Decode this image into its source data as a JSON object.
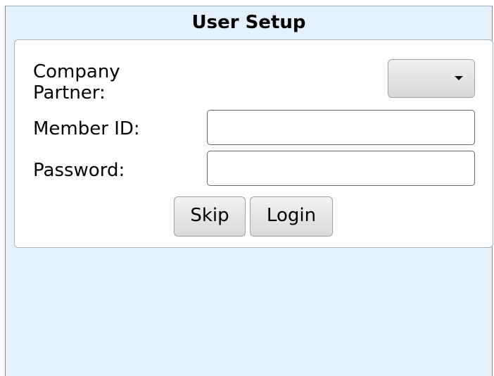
{
  "dialog": {
    "title": "User Setup"
  },
  "form": {
    "company_partner": {
      "label": "Company Partner:",
      "selected_value": ""
    },
    "member_id": {
      "label": "Member ID:",
      "value": "",
      "placeholder": ""
    },
    "password": {
      "label": "Password:",
      "value": "",
      "placeholder": ""
    }
  },
  "buttons": {
    "skip_label": "Skip",
    "login_label": "Login"
  },
  "colors": {
    "window_background": "#e4f1fc",
    "panel_background": "#ffffff"
  }
}
